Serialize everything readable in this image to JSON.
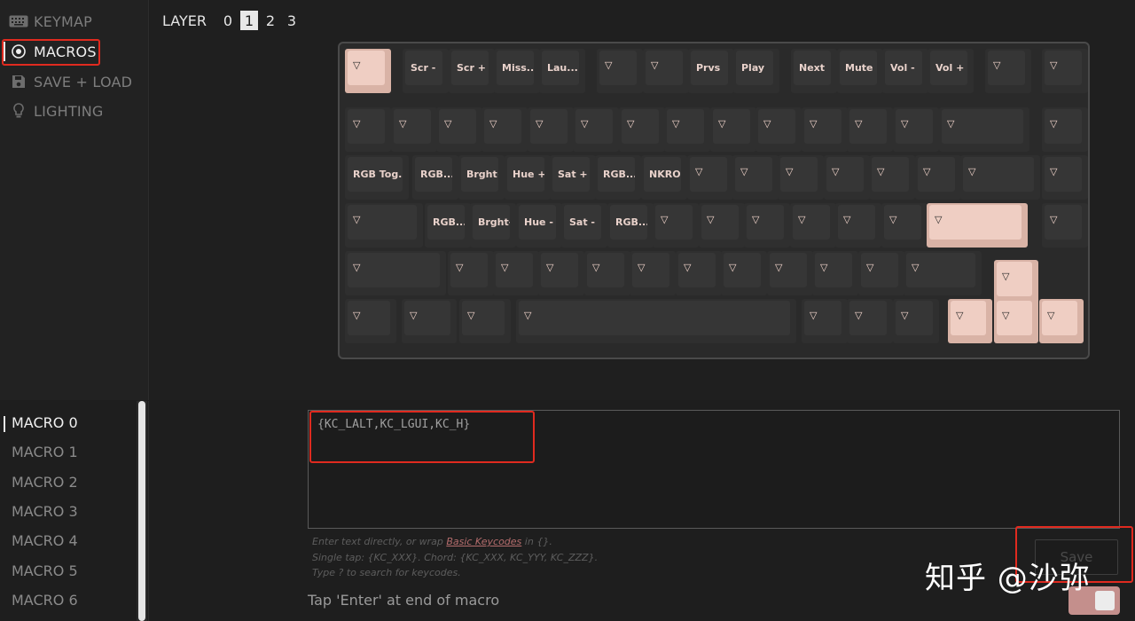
{
  "sidebar": {
    "items": [
      {
        "label": "KEYMAP",
        "icon": "keyboard-icon",
        "active": false
      },
      {
        "label": "MACROS",
        "icon": "record-icon",
        "active": true
      },
      {
        "label": "SAVE + LOAD",
        "icon": "floppy-disk-icon",
        "active": false
      },
      {
        "label": "LIGHTING",
        "icon": "lightbulb-icon",
        "active": false
      }
    ]
  },
  "layers": {
    "title": "LAYER",
    "options": [
      "0",
      "1",
      "2",
      "3"
    ],
    "selected": "1"
  },
  "keyboard": {
    "triangle_glyph": "▽",
    "rows": [
      [
        "▽",
        "Scr -",
        "Scr +",
        "Miss...",
        "Lau...",
        "▽",
        "▽",
        "Prvs",
        "Play",
        "Next",
        "Mute",
        "Vol -",
        "Vol +",
        "▽",
        "▽"
      ],
      [
        "▽",
        "▽",
        "▽",
        "▽",
        "▽",
        "▽",
        "▽",
        "▽",
        "▽",
        "▽",
        "▽",
        "▽",
        "▽",
        "▽",
        "▽"
      ],
      [
        "RGB Tog...",
        "RGB...",
        "Brght+",
        "Hue +",
        "Sat +",
        "RGB...",
        "NKRO",
        "▽",
        "▽",
        "▽",
        "▽",
        "▽",
        "▽",
        "▽",
        "▽"
      ],
      [
        "▽",
        "RGB...",
        "Brght-",
        "Hue -",
        "Sat -",
        "RGB...",
        "▽",
        "▽",
        "▽",
        "▽",
        "▽",
        "▽",
        "▽",
        "▽"
      ],
      [
        "▽",
        "▽",
        "▽",
        "▽",
        "▽",
        "▽",
        "▽",
        "▽",
        "▽",
        "▽",
        "▽",
        "▽",
        "▽"
      ],
      [
        "▽",
        "▽",
        "▽",
        "▽",
        "▽",
        "▽",
        "▽",
        "▽",
        "▽",
        "▽"
      ]
    ]
  },
  "macros": {
    "items": [
      "MACRO 0",
      "MACRO 1",
      "MACRO 2",
      "MACRO 3",
      "MACRO 4",
      "MACRO 5",
      "MACRO 6"
    ],
    "selected": "MACRO 0"
  },
  "editor": {
    "value": "{KC_LALT,KC_LGUI,KC_H}",
    "help_line1_before": "Enter text directly, or wrap ",
    "help_link": "Basic Keycodes",
    "help_line1_after": " in {}.",
    "help_line2": "Single tap: {KC_XXX}. Chord: {KC_XXX, KC_YYY, KC_ZZZ}.",
    "help_line3": "Type ? to search for keycodes.",
    "save_label": "Save",
    "enter_label": "Tap 'Enter' at end of macro",
    "enter_toggle_on": true
  },
  "watermark": "知乎 @沙弥",
  "colors": {
    "accent_pink": "#efcec3",
    "highlight_red": "#e02a1f",
    "toggle_on": "#c48f8c"
  }
}
